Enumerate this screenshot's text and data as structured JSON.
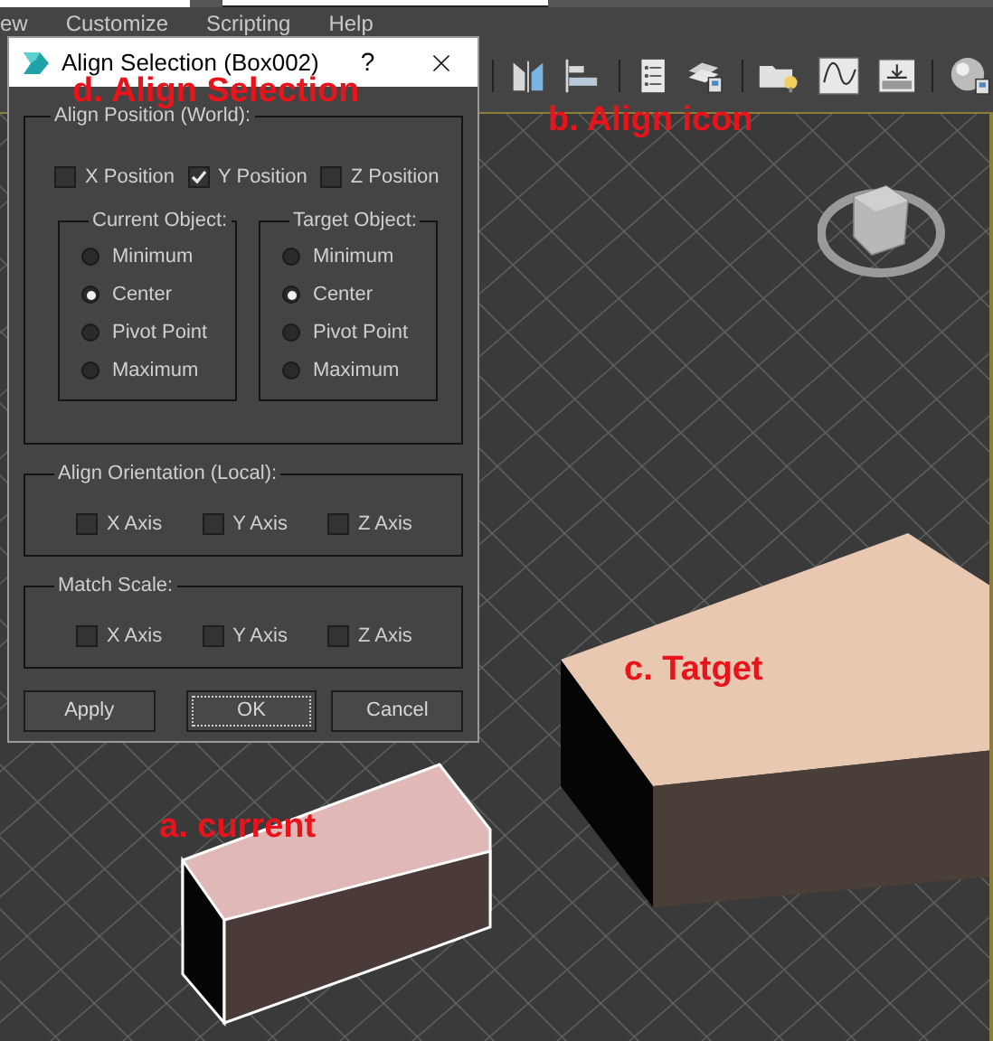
{
  "menu_bar": {
    "items": [
      "ew",
      "Customize",
      "Scripting",
      "Help"
    ]
  },
  "dialog": {
    "title": "Align Selection (Box002)",
    "help": "?",
    "align_position": {
      "title": "Align Position (World):",
      "axes": [
        {
          "label": "X Position",
          "checked": false
        },
        {
          "label": "Y Position",
          "checked": true
        },
        {
          "label": "Z Position",
          "checked": false
        }
      ],
      "current_object": {
        "title": "Current Object:",
        "options": [
          {
            "label": "Minimum",
            "selected": false
          },
          {
            "label": "Center",
            "selected": true
          },
          {
            "label": "Pivot Point",
            "selected": false
          },
          {
            "label": "Maximum",
            "selected": false
          }
        ]
      },
      "target_object": {
        "title": "Target Object:",
        "options": [
          {
            "label": "Minimum",
            "selected": false
          },
          {
            "label": "Center",
            "selected": true
          },
          {
            "label": "Pivot Point",
            "selected": false
          },
          {
            "label": "Maximum",
            "selected": false
          }
        ]
      }
    },
    "align_orientation": {
      "title": "Align Orientation (Local):",
      "axes": [
        {
          "label": "X Axis",
          "checked": false
        },
        {
          "label": "Y Axis",
          "checked": false
        },
        {
          "label": "Z Axis",
          "checked": false
        }
      ]
    },
    "match_scale": {
      "title": "Match Scale:",
      "axes": [
        {
          "label": "X Axis",
          "checked": false
        },
        {
          "label": "Y Axis",
          "checked": false
        },
        {
          "label": "Z Axis",
          "checked": false
        }
      ]
    },
    "buttons": [
      {
        "label": "Apply",
        "focused": false
      },
      {
        "label": "OK",
        "focused": true
      },
      {
        "label": "Cancel",
        "focused": false
      }
    ]
  },
  "annotations": [
    {
      "text": "d. Align Selection"
    },
    {
      "text": "b. Align icon"
    },
    {
      "text": "c. Tatget"
    },
    {
      "text": "a. current"
    }
  ]
}
